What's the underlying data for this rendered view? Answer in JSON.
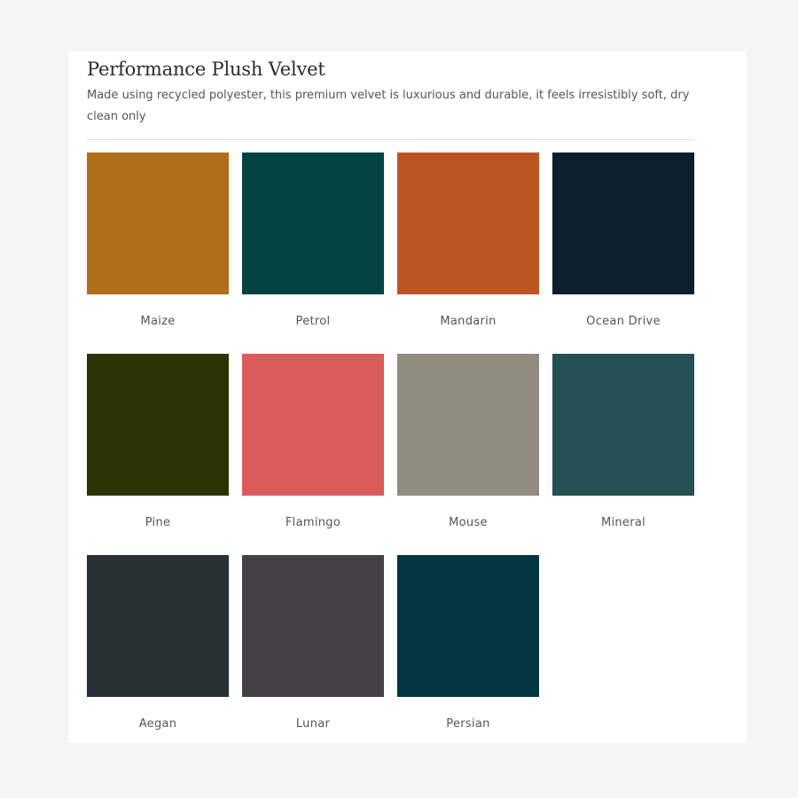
{
  "product": {
    "title": "Performance Plush Velvet",
    "description": "Made using recycled polyester, this premium velvet is luxurious and durable, it feels irresistibly soft, dry clean only"
  },
  "swatches": [
    {
      "name": "Maize",
      "color": "#b06e1a"
    },
    {
      "name": "Petrol",
      "color": "#034443"
    },
    {
      "name": "Mandarin",
      "color": "#bd5523"
    },
    {
      "name": "Ocean Drive",
      "color": "#0c1f2c"
    },
    {
      "name": "Pine",
      "color": "#2c3403"
    },
    {
      "name": "Flamingo",
      "color": "#da5b5a"
    },
    {
      "name": "Mouse",
      "color": "#928b80"
    },
    {
      "name": "Mineral",
      "color": "#245153"
    },
    {
      "name": "Aegan",
      "color": "#283133"
    },
    {
      "name": "Lunar",
      "color": "#434145"
    },
    {
      "name": "Persian",
      "color": "#033640"
    }
  ]
}
